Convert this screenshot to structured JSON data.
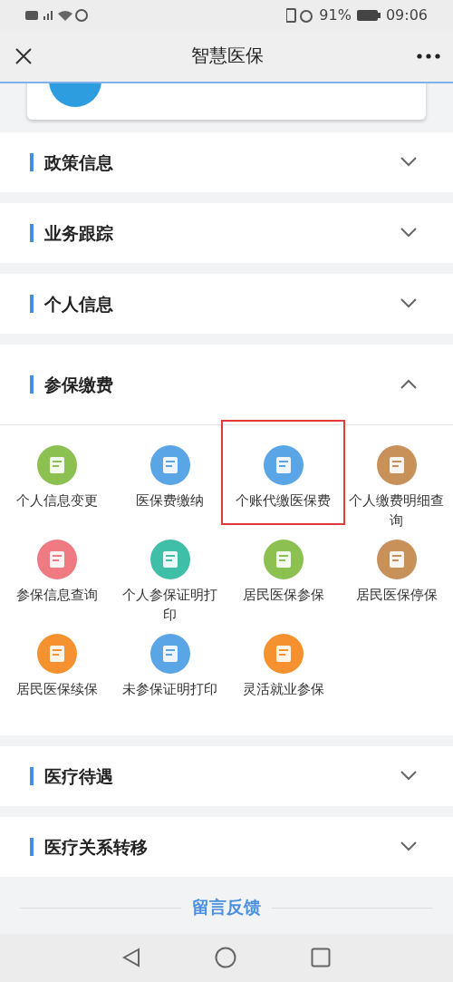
{
  "status_bar": {
    "battery": "91%",
    "time": "09:06"
  },
  "header": {
    "title": "智慧医保"
  },
  "sections": [
    {
      "title": "政策信息",
      "expanded": false
    },
    {
      "title": "业务跟踪",
      "expanded": false
    },
    {
      "title": "个人信息",
      "expanded": false
    },
    {
      "title": "参保缴费",
      "expanded": true,
      "items": [
        {
          "label": "个人信息变更",
          "color": "#8cc152",
          "highlighted": false
        },
        {
          "label": "医保费缴纳",
          "color": "#5aa5e6",
          "highlighted": false
        },
        {
          "label": "个账代缴医保费",
          "color": "#5aa5e6",
          "highlighted": true
        },
        {
          "label": "个人缴费明细查询",
          "color": "#c9915a",
          "highlighted": false
        },
        {
          "label": "参保信息查询",
          "color": "#ef7a82",
          "highlighted": false
        },
        {
          "label": "个人参保证明打印",
          "color": "#3fbfa8",
          "highlighted": false
        },
        {
          "label": "居民医保参保",
          "color": "#8cc152",
          "highlighted": false
        },
        {
          "label": "居民医保停保",
          "color": "#c9915a",
          "highlighted": false
        },
        {
          "label": "居民医保续保",
          "color": "#f5922f",
          "highlighted": false
        },
        {
          "label": "未参保证明打印",
          "color": "#5aa5e6",
          "highlighted": false
        },
        {
          "label": "灵活就业参保",
          "color": "#f5922f",
          "highlighted": false
        }
      ]
    },
    {
      "title": "医疗待遇",
      "expanded": false
    },
    {
      "title": "医疗关系转移",
      "expanded": false
    }
  ],
  "feedback": "留言反馈"
}
